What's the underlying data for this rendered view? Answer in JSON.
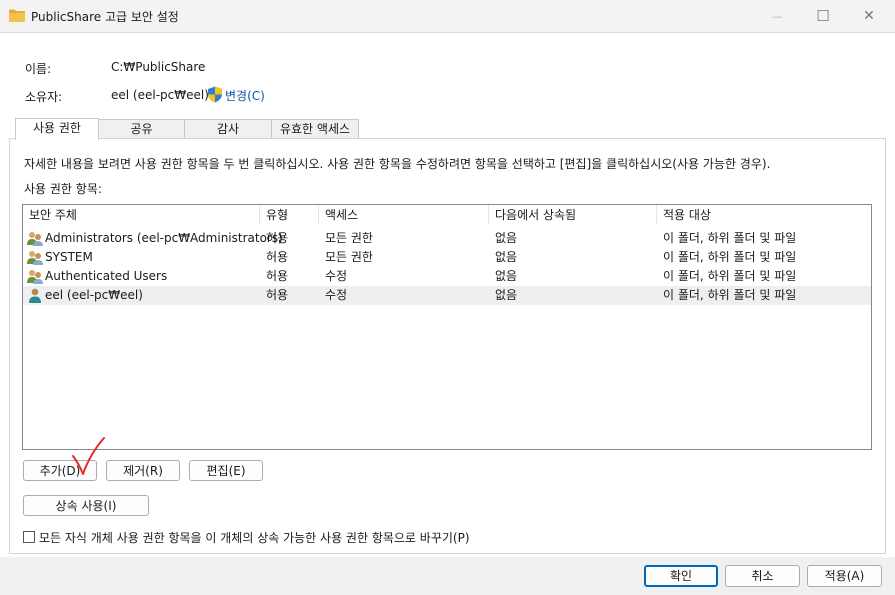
{
  "window": {
    "title": "PublicShare 고급 보안 설정",
    "minimize_glyph": "—",
    "maximize_glyph": "☐",
    "close_glyph": "✕"
  },
  "info": {
    "name_label": "이름:",
    "name_value": "C:₩PublicShare",
    "owner_label": "소유자:",
    "owner_value": "eel (eel-pc₩eel)",
    "change_label": "변경(C)"
  },
  "tabs": [
    {
      "label": "사용 권한"
    },
    {
      "label": "공유"
    },
    {
      "label": "감사"
    },
    {
      "label": "유효한 액세스"
    }
  ],
  "permissions": {
    "description": "자세한 내용을 보려면 사용 권한 항목을 두 번 클릭하십시오. 사용 권한 항목을 수정하려면 항목을 선택하고 [편집]을 클릭하십시오(사용 가능한 경우).",
    "list_label": "사용 권한 항목:",
    "columns": [
      "보안 주체",
      "유형",
      "액세스",
      "다음에서 상속됨",
      "적용 대상"
    ],
    "rows": [
      {
        "icon": "users-icon",
        "principal": "Administrators (eel-pc₩Administrators)",
        "type": "허용",
        "access": "모든 권한",
        "inherited": "없음",
        "applies": "이 폴더, 하위 폴더 및 파일"
      },
      {
        "icon": "users-icon",
        "principal": "SYSTEM",
        "type": "허용",
        "access": "모든 권한",
        "inherited": "없음",
        "applies": "이 폴더, 하위 폴더 및 파일"
      },
      {
        "icon": "users-icon",
        "principal": "Authenticated Users",
        "type": "허용",
        "access": "수정",
        "inherited": "없음",
        "applies": "이 폴더, 하위 폴더 및 파일"
      },
      {
        "icon": "user-icon",
        "principal": "eel (eel-pc₩eel)",
        "type": "허용",
        "access": "수정",
        "inherited": "없음",
        "applies": "이 폴더, 하위 폴더 및 파일"
      }
    ],
    "add_button": "추가(D)",
    "remove_button": "제거(R)",
    "edit_button": "편집(E)",
    "inheritance_button": "상속 사용(I)",
    "replace_checkbox_label": "모든 자식 개체 사용 권한 항목을 이 개체의 상속 가능한 사용 권한 항목으로 바꾸기(P)",
    "replace_checked": false
  },
  "footer": {
    "ok_button": "확인",
    "cancel_button": "취소",
    "apply_button": "적용(A)"
  },
  "colors": {
    "accent": "#0067c0",
    "link": "#0b57a5",
    "annotation": "#e8292a",
    "folder": "#f4c04e"
  }
}
